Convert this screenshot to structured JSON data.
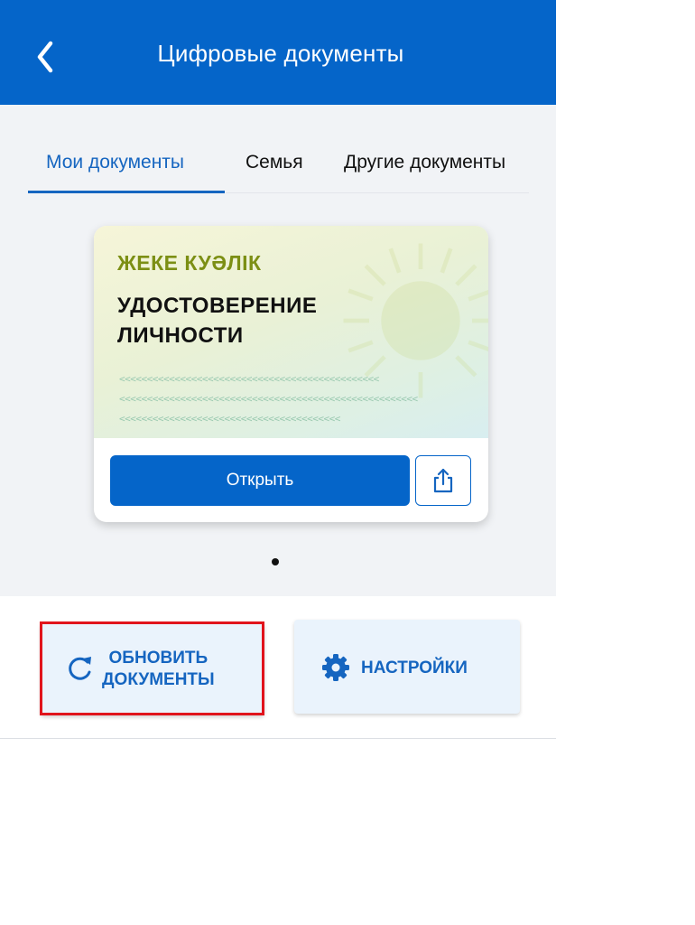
{
  "header": {
    "title": "Цифровые документы",
    "back_icon": "chevron-left-icon"
  },
  "tabs": [
    {
      "label": "Мои документы",
      "active": true
    },
    {
      "label": "Семья",
      "active": false
    },
    {
      "label": "Другие документы",
      "active": false
    }
  ],
  "card": {
    "title_kz": "ЖЕКЕ КУӘЛІК",
    "title_ru_line1": "УДОСТОВЕРЕНИЕ",
    "title_ru_line2": "ЛИЧНОСТИ",
    "mrz_line1": "<<<<<<<<<<<<<<<<<<<<<<<<<<<<<<<<<<<<<<<<<<<<<<<",
    "mrz_line2": "<<<<<<<<<<<<<<<<<<<<<<<<<<<<<<<<<<<<<<<<<<<<<<<<<<<<<<",
    "mrz_line3": "<<<<<<<<<<<<<<<<<<<<<<<<<<<<<<<<<<<<<<<<",
    "open_label": "Открыть",
    "share_icon": "share-icon"
  },
  "pager": {
    "current": 1,
    "total": 1
  },
  "actions": {
    "refresh_line1": "ОБНОВИТЬ",
    "refresh_line2": "ДОКУМЕНТЫ",
    "settings_label": "НАСТРОЙКИ"
  },
  "colors": {
    "primary": "#0565c9",
    "accent_text": "#1565c0",
    "highlight": "#e1141c",
    "kz_title": "#7c8f14"
  }
}
